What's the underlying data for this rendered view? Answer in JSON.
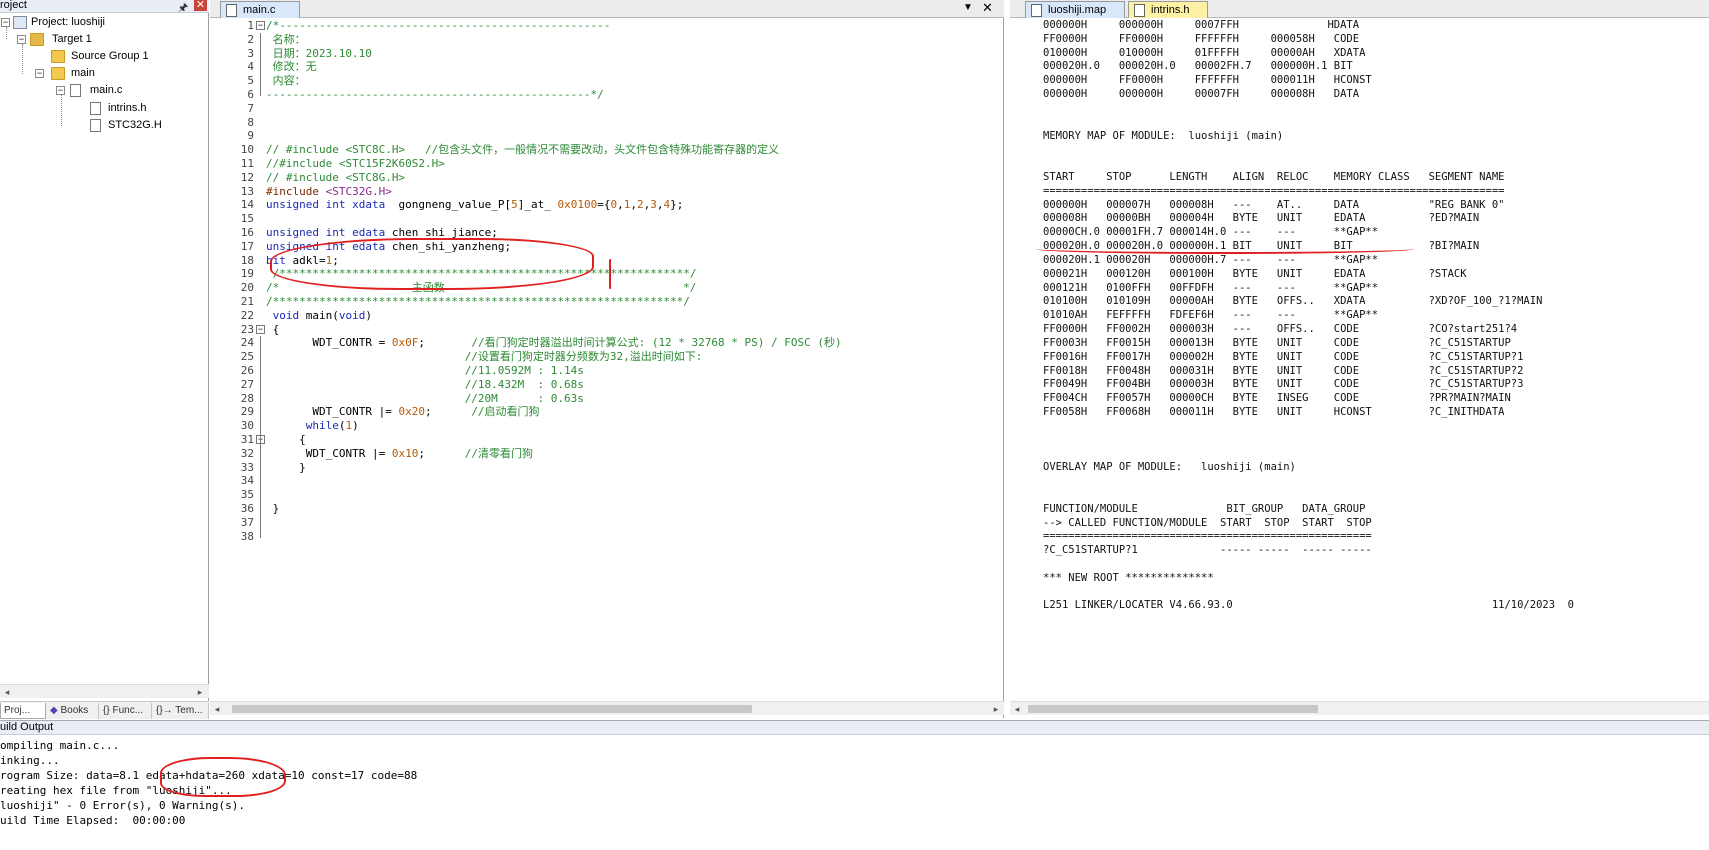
{
  "project_panel": {
    "title": "roject",
    "tree": [
      {
        "label": "Project: luoshiji",
        "level": 0
      },
      {
        "label": "Target 1",
        "level": 1
      },
      {
        "label": "Source Group 1",
        "level": 2
      },
      {
        "label": "main",
        "level": 2
      },
      {
        "label": "main.c",
        "level": 3
      },
      {
        "label": "intrins.h",
        "level": 4
      },
      {
        "label": "STC32G.H",
        "level": 4
      }
    ],
    "tabs": [
      "Proj...",
      "Books",
      "{} Func...",
      "{}→ Tem..."
    ]
  },
  "editor": {
    "tab": "main.c",
    "line_numbers": [
      "1",
      "2",
      "3",
      "4",
      "5",
      "6",
      "7",
      "8",
      "9",
      "10",
      "11",
      "12",
      "13",
      "14",
      "15",
      "16",
      "17",
      "18",
      "19",
      "20",
      "21",
      "22",
      "23",
      "24",
      "25",
      "26",
      "27",
      "28",
      "29",
      "30",
      "31",
      "32",
      "33",
      "34",
      "35",
      "36",
      "37",
      "38"
    ],
    "code": [
      "/*--------------------------------------------------",
      " 名称：",
      " 日期：2023.10.10",
      " 修改：无",
      " 内容：",
      "-------------------------------------------------*/",
      "",
      "",
      "",
      "// #include <STC8C.H>   //包含头文件，一般情况不需要改动，头文件包含特殊功能寄存器的定义",
      "//#include <STC15F2K60S2.H>",
      "// #include <STC8G.H>",
      "#include <STC32G.H>",
      "unsigned int xdata  gongneng_value_P[5]_at_ 0x0100={0,1,2,3,4};",
      "",
      "unsigned int edata chen_shi_jiance;",
      "unsigned int edata chen_shi_yanzheng;",
      "bit adkl=1;",
      " /**************************************************************/",
      "/*                    主函数                                    */",
      "/**************************************************************/",
      " void main(void)",
      " {",
      "       WDT_CONTR = 0x0F;       //看门狗定时器溢出时间计算公式: (12 * 32768 * PS) / FOSC (秒)",
      "                              //设置看门狗定时器分频数为32,溢出时间如下:",
      "                              //11.0592M : 1.14s",
      "                              //18.432M  : 0.68s",
      "                              //20M      : 0.63s",
      "       WDT_CONTR |= 0x20;      //启动看门狗",
      "      while(1)",
      "     {",
      "      WDT_CONTR |= 0x10;      //清零看门狗",
      "     }",
      "",
      "",
      " }",
      "",
      ""
    ]
  },
  "map_panel": {
    "tabs": [
      "luoshiji.map",
      "intrins.h"
    ],
    "lines": [
      "000000H     000000H     0007FFH              HDATA",
      "FF0000H     FF0000H     FFFFFFH     000058H   CODE",
      "010000H     010000H     01FFFFH     00000AH   XDATA",
      "000020H.0   000020H.0   00002FH.7   000000H.1 BIT",
      "000000H     FF0000H     FFFFFFH     000011H   HCONST",
      "000000H     000000H     00007FH     000008H   DATA",
      "",
      "",
      "MEMORY MAP OF MODULE:  luoshiji (main)",
      "",
      "",
      "START     STOP      LENGTH    ALIGN  RELOC    MEMORY CLASS   SEGMENT NAME",
      "=========================================================================",
      "000000H   000007H   000008H   ---    AT..     DATA           \"REG BANK 0\"",
      "000008H   00000BH   000004H   BYTE   UNIT     EDATA          ?ED?MAIN",
      "00000CH.0 00001FH.7 000014H.0 ---    ---      **GAP**",
      "000020H.0 000020H.0 000000H.1 BIT    UNIT     BIT            ?BI?MAIN",
      "000020H.1 000020H   000000H.7 ---    ---      **GAP**",
      "000021H   000120H   000100H   BYTE   UNIT     EDATA          ?STACK",
      "000121H   0100FFH   00FFDFH   ---    ---      **GAP**",
      "010100H   010109H   00000AH   BYTE   OFFS..   XDATA          ?XD?OF_100_?1?MAIN",
      "01010AH   FEFFFFH   FDFEF6H   ---    ---      **GAP**",
      "FF0000H   FF0002H   000003H   ---    OFFS..   CODE           ?CO?start251?4",
      "FF0003H   FF0015H   000013H   BYTE   UNIT     CODE           ?C_C51STARTUP",
      "FF0016H   FF0017H   000002H   BYTE   UNIT     CODE           ?C_C51STARTUP?1",
      "FF0018H   FF0048H   000031H   BYTE   UNIT     CODE           ?C_C51STARTUP?2",
      "FF0049H   FF004BH   000003H   BYTE   UNIT     CODE           ?C_C51STARTUP?3",
      "FF004CH   FF0057H   00000CH   BYTE   INSEG    CODE           ?PR?MAIN?MAIN",
      "FF0058H   FF0068H   000011H   BYTE   UNIT     HCONST         ?C_INITHDATA",
      "",
      "",
      "",
      "OVERLAY MAP OF MODULE:   luoshiji (main)",
      "",
      "",
      "FUNCTION/MODULE              BIT_GROUP   DATA_GROUP",
      "--> CALLED FUNCTION/MODULE  START  STOP  START  STOP",
      "====================================================",
      "?C_C51STARTUP?1             ----- -----  ----- -----",
      "",
      "*** NEW ROOT **************",
      "",
      "L251 LINKER/LOCATER V4.66.93.0                                         11/10/2023  0"
    ]
  },
  "build_output": {
    "title": "uild Output",
    "lines": [
      "ompiling main.c...",
      "inking...",
      "rogram Size: data=8.1 edata+hdata=260 xdata=10 const=17 code=88",
      "reating hex file from \"luoshiji\"...",
      "luoshiji\" - 0 Error(s), 0 Warning(s).",
      "uild Time Elapsed:  00:00:00"
    ]
  },
  "colors": {
    "comment": "#2d8a35",
    "keyword": "#1a2bb8",
    "annotation": "#e02020"
  }
}
